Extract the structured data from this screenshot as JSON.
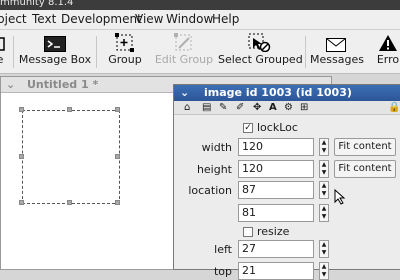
{
  "window": {
    "title": "mmunity 8.1.4"
  },
  "menubar": {
    "items": [
      "bject",
      "Text",
      "Development",
      "View",
      "Window",
      "Help"
    ]
  },
  "toolbar": {
    "tools": [
      {
        "label": "e",
        "icon": "edit-icon"
      },
      {
        "label": "Message Box",
        "icon": "terminal-icon"
      },
      {
        "label": "Group",
        "icon": "group-icon"
      },
      {
        "label": "Edit Group",
        "icon": "edit-group-icon",
        "disabled": true
      },
      {
        "label": "Select Grouped",
        "icon": "select-grouped-icon"
      },
      {
        "label": "Messages",
        "icon": "envelope-icon"
      },
      {
        "label": "Erro",
        "icon": "warning-icon"
      }
    ]
  },
  "stack_window": {
    "title": "Untitled 1 *"
  },
  "inspector": {
    "title": "image id 1003 (id 1003)",
    "props": {
      "lockLoc_label": "lockLoc",
      "lockLoc_checked": true,
      "width_label": "width",
      "width_value": "120",
      "height_label": "height",
      "height_value": "120",
      "location_label": "location",
      "location_x": "87",
      "location_y": "81",
      "resize_label": "resize",
      "resize_checked": false,
      "left_label": "left",
      "left_value": "27",
      "top_label": "top",
      "top_value": "21"
    },
    "fit_label": "Fit content"
  }
}
